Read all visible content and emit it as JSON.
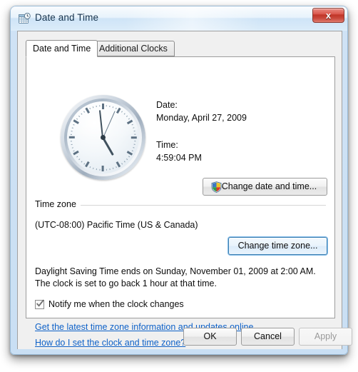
{
  "window": {
    "title": "Date and Time",
    "icon": "calendar-clock-icon",
    "close_label": "x"
  },
  "tabs": [
    {
      "label": "Date and Time",
      "active": true
    },
    {
      "label": "Additional Clocks",
      "active": false
    }
  ],
  "datetime": {
    "date_label": "Date:",
    "date_value": "Monday, April 27, 2009",
    "time_label": "Time:",
    "time_value": "4:59:04 PM",
    "change_button": "Change date and time...",
    "clock": {
      "hour_angle": 150,
      "minute_angle": 354,
      "second_angle": 24
    }
  },
  "timezone": {
    "group_label": "Time zone",
    "value": "(UTC-08:00) Pacific Time (US & Canada)",
    "change_button": "Change time zone..."
  },
  "dst": {
    "text": "Daylight Saving Time ends on Sunday, November 01, 2009 at 2:00 AM. The clock is set to go back 1 hour at that time.",
    "notify_label": "Notify me when the clock changes",
    "notify_checked": true
  },
  "links": [
    {
      "label": "Get the latest time zone information and updates online"
    },
    {
      "label": "How do I set the clock and time zone?"
    }
  ],
  "footer": {
    "ok": "OK",
    "cancel": "Cancel",
    "apply": "Apply",
    "apply_disabled": true
  },
  "colors": {
    "link": "#0f62c8",
    "accent_border": "#3c7fb1",
    "close_red": "#c03527",
    "titlebar_text": "#16334d"
  }
}
